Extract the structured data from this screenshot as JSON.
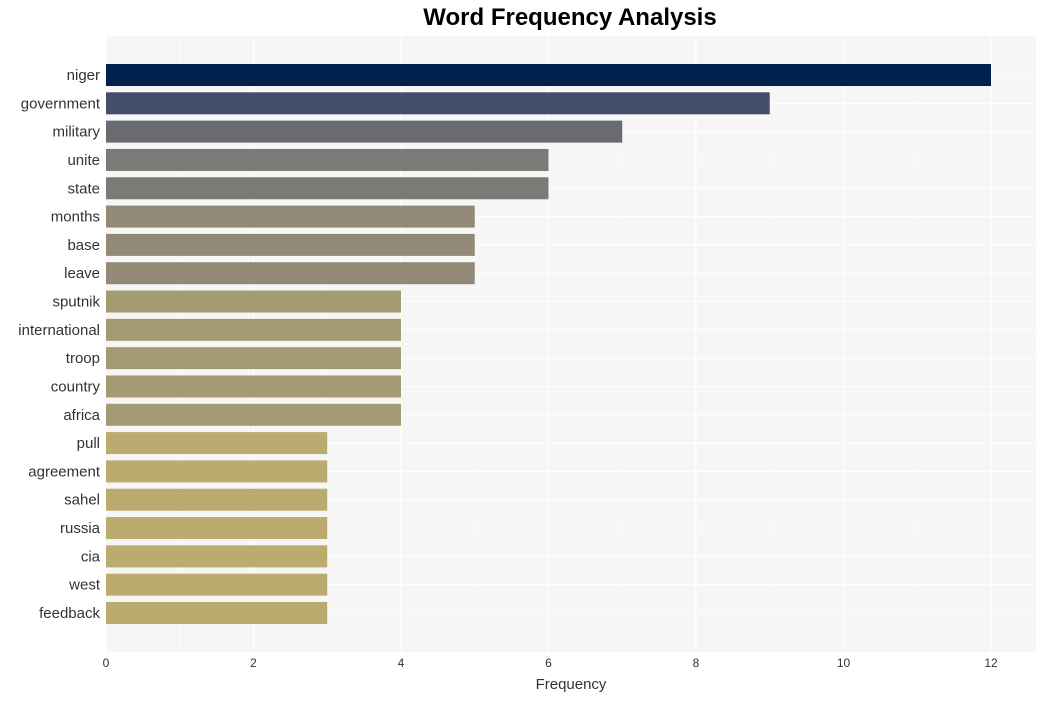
{
  "chart_data": {
    "type": "bar",
    "orientation": "horizontal",
    "title": "Word Frequency Analysis",
    "xlabel": "Frequency",
    "ylabel": "",
    "xlim": [
      0,
      12.6
    ],
    "xticks": [
      0,
      2,
      4,
      6,
      8,
      10,
      12
    ],
    "grid": true,
    "categories": [
      "niger",
      "government",
      "military",
      "unite",
      "state",
      "months",
      "base",
      "leave",
      "sputnik",
      "international",
      "troop",
      "country",
      "africa",
      "pull",
      "agreement",
      "sahel",
      "russia",
      "cia",
      "west",
      "feedback"
    ],
    "values": [
      12,
      9,
      7,
      6,
      6,
      5,
      5,
      5,
      4,
      4,
      4,
      4,
      4,
      3,
      3,
      3,
      3,
      3,
      3,
      3
    ],
    "colors": [
      "#00204e",
      "#434e6c",
      "#6a6b71",
      "#7b7a77",
      "#7b7a77",
      "#928a76",
      "#928a76",
      "#928a76",
      "#a59b73",
      "#a59b73",
      "#a59b73",
      "#a59b73",
      "#a59b73",
      "#bbab6e",
      "#bbab6e",
      "#bbab6e",
      "#bbab6e",
      "#bbab6e",
      "#bbab6e",
      "#bbab6e"
    ],
    "background_color": "#f6f6f6"
  }
}
